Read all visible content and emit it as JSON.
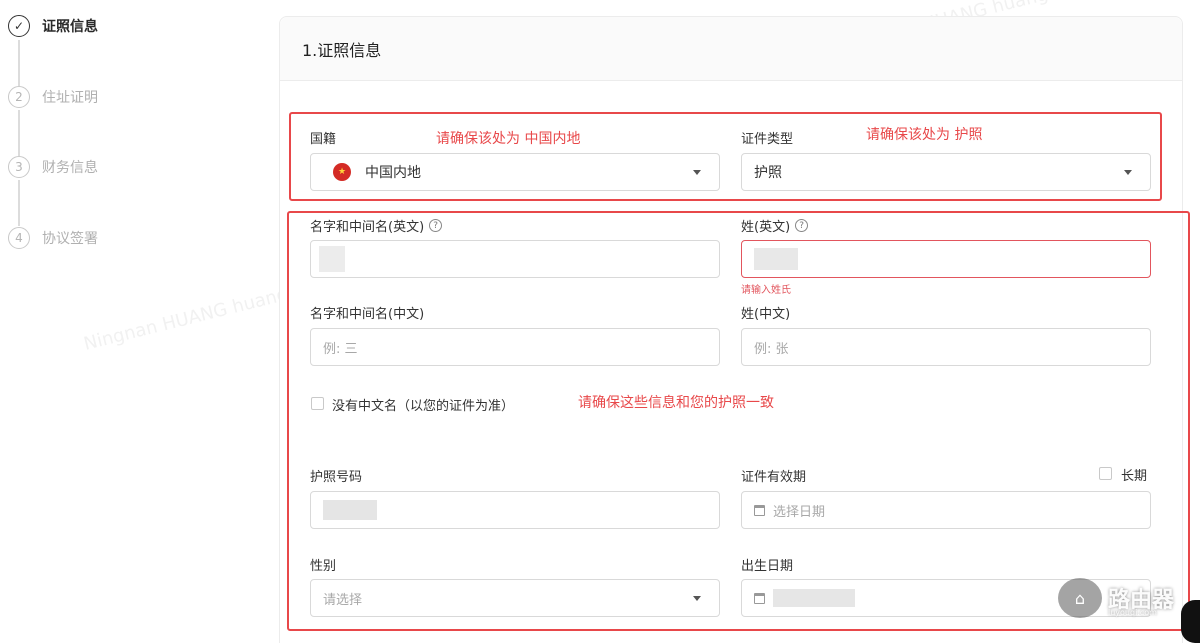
{
  "steps": [
    {
      "num": "✓",
      "label": "证照信息",
      "active": true
    },
    {
      "num": "2",
      "label": "住址证明",
      "active": false
    },
    {
      "num": "3",
      "label": "财务信息",
      "active": false
    },
    {
      "num": "4",
      "label": "协议签署",
      "active": false
    }
  ],
  "card": {
    "title": "1.证照信息"
  },
  "fields": {
    "nationality": {
      "label": "国籍",
      "value": "中国内地"
    },
    "id_type": {
      "label": "证件类型",
      "value": "护照"
    },
    "first_name_en": {
      "label": "名字和中间名(英文)"
    },
    "last_name_en": {
      "label": "姓(英文)",
      "error": "请输入姓氏"
    },
    "first_name_cn": {
      "label": "名字和中间名(中文)",
      "placeholder": "例: 三"
    },
    "last_name_cn": {
      "label": "姓(中文)",
      "placeholder": "例: 张"
    },
    "no_chinese_name": {
      "label": "没有中文名（以您的证件为准）"
    },
    "passport_no": {
      "label": "护照号码"
    },
    "expiry": {
      "label": "证件有效期",
      "placeholder": "选择日期",
      "long_term_label": "长期"
    },
    "gender": {
      "label": "性别",
      "placeholder": "请选择"
    },
    "birth_date": {
      "label": "出生日期"
    }
  },
  "annotations": {
    "nationality_note": "请确保该处为 中国内地",
    "id_type_note": "请确保该处为 护照",
    "consistency_note": "请确保这些信息和您的护照一致"
  },
  "watermark": "Ningnan HUANG huangningnan",
  "brand": {
    "name": "路由器",
    "sub": "luyouqi.com"
  },
  "icons": {
    "flag": "china-flag-icon",
    "help": "question-circle-icon",
    "calendar": "calendar-icon",
    "dropdown": "caret-down-icon"
  },
  "colors": {
    "annotation": "#e8484a",
    "error": "#e2555d"
  }
}
